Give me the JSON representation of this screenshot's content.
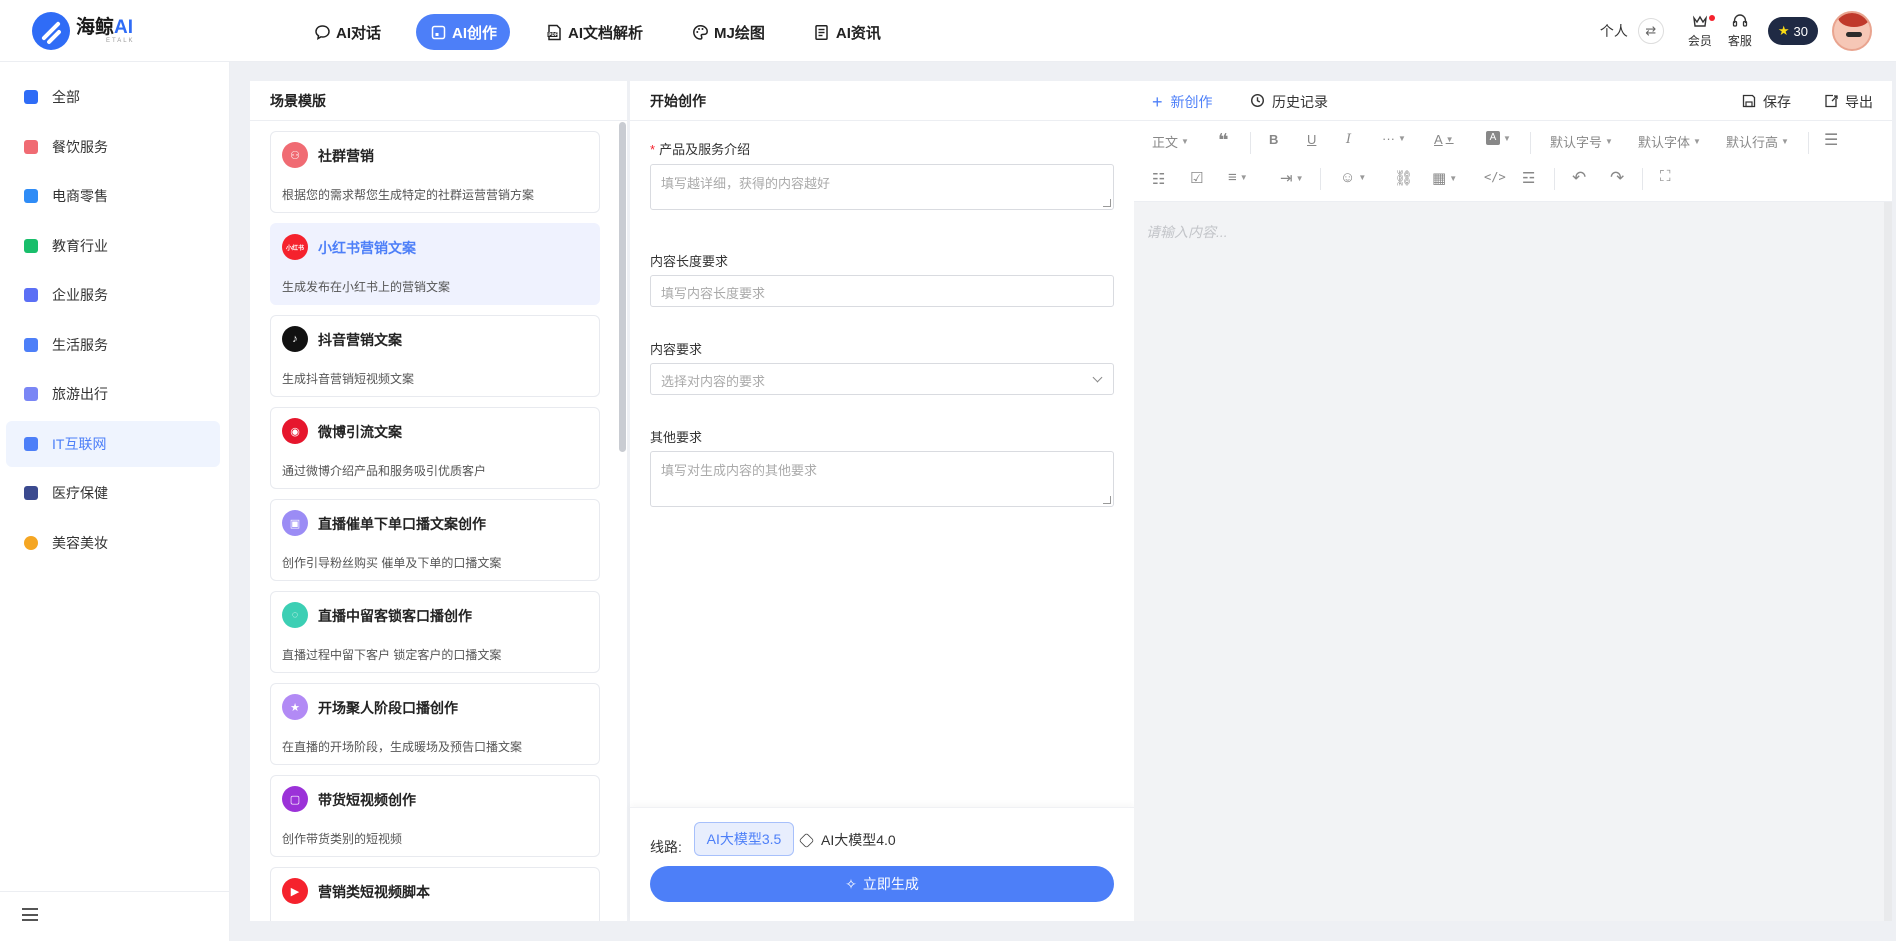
{
  "app": {
    "logo_name": "海鲸",
    "logo_ai": "AI",
    "logo_sub": "ETALK",
    "brand_color": "#2f6cf6",
    "accent_color": "#4d7ff8"
  },
  "nav": [
    {
      "label": "AI对话",
      "icon": "chat-icon",
      "active": false
    },
    {
      "label": "AI创作",
      "icon": "create-icon",
      "active": true
    },
    {
      "label": "AI文档解析",
      "icon": "pdf-icon",
      "active": false
    },
    {
      "label": "MJ绘图",
      "icon": "palette-icon",
      "active": false
    },
    {
      "label": "AI资讯",
      "icon": "news-icon",
      "active": false
    }
  ],
  "topbar": {
    "personal": "个人",
    "vip_label": "会员",
    "service_label": "客服",
    "points": "30"
  },
  "sidebar": {
    "items": [
      {
        "label": "全部",
        "icon": "windows-icon",
        "color": "#2f6cf6",
        "active": false
      },
      {
        "label": "餐饮服务",
        "icon": "food-icon",
        "color": "#f06b73",
        "active": false
      },
      {
        "label": "电商零售",
        "icon": "graduation-icon",
        "color": "#2f8cf6",
        "active": false
      },
      {
        "label": "教育行业",
        "icon": "book-icon",
        "color": "#19be6b",
        "active": false
      },
      {
        "label": "企业服务",
        "icon": "building-icon",
        "color": "#5b6ff5",
        "active": false
      },
      {
        "label": "生活服务",
        "icon": "brush-icon",
        "color": "#4d7ff8",
        "active": false
      },
      {
        "label": "旅游出行",
        "icon": "mountain-icon",
        "color": "#7a86f5",
        "active": false
      },
      {
        "label": "IT互联网",
        "icon": "document-icon",
        "color": "#4d7ff8",
        "active": true
      },
      {
        "label": "医疗保健",
        "icon": "hospital-icon",
        "color": "#3b4a8f",
        "active": false
      },
      {
        "label": "美容美妆",
        "icon": "smile-icon",
        "color": "#f5a623",
        "active": false
      }
    ]
  },
  "templates": {
    "title": "场景模版",
    "items": [
      {
        "title": "社群营销",
        "desc": "根据您的需求帮您生成特定的社群运营营销方案",
        "icon": "group-icon",
        "color": "#f06b73",
        "glyph": "⚇",
        "active": false
      },
      {
        "title": "小红书营销文案",
        "desc": "生成发布在小红书上的营销文案",
        "icon": "xiaohongshu-icon",
        "color": "#f5222d",
        "glyph": "小红书",
        "active": true
      },
      {
        "title": "抖音营销文案",
        "desc": "生成抖音营销短视频文案",
        "icon": "douyin-icon",
        "color": "#111111",
        "glyph": "♪",
        "active": false
      },
      {
        "title": "微博引流文案",
        "desc": "通过微博介绍产品和服务吸引优质客户",
        "icon": "weibo-icon",
        "color": "#e6162d",
        "glyph": "◉",
        "active": false
      },
      {
        "title": "直播催单下单口播文案创作",
        "desc": "创作引导粉丝购买 催单及下单的口播文案",
        "icon": "live-camera-icon",
        "color": "#9b8cf5",
        "glyph": "▣",
        "active": false
      },
      {
        "title": "直播中留客锁客口播创作",
        "desc": "直播过程中留下客户 锁定客户的口播文案",
        "icon": "chat-bubble-icon",
        "color": "#3ccfb4",
        "glyph": "◌",
        "active": false
      },
      {
        "title": "开场聚人阶段口播创作",
        "desc": "在直播的开场阶段，生成暖场及预告口播文案",
        "icon": "star-badge-icon",
        "color": "#b28af5",
        "glyph": "★",
        "active": false
      },
      {
        "title": "带货短视频创作",
        "desc": "创作带货类别的短视频",
        "icon": "shopping-icon",
        "color": "#9b32d8",
        "glyph": "▢",
        "active": false
      },
      {
        "title": "营销类短视频脚本",
        "desc": "",
        "icon": "play-icon",
        "color": "#f5222d",
        "glyph": "▶",
        "active": false
      }
    ]
  },
  "create": {
    "title": "开始创作",
    "fields": {
      "intro_label": "产品及服务介绍",
      "intro_placeholder": "填写越详细，获得的内容越好",
      "length_label": "内容长度要求",
      "length_placeholder": "填写内容长度要求",
      "req_label": "内容要求",
      "req_placeholder": "选择对内容的要求",
      "other_label": "其他要求",
      "other_placeholder": "填写对生成内容的其他要求"
    },
    "route_label": "线路:",
    "model_selected": "AI大模型3.5",
    "model_alt": "AI大模型4.0",
    "generate_label": "立即生成"
  },
  "editor": {
    "new_label": "新创作",
    "history_label": "历史记录",
    "save_label": "保存",
    "export_label": "导出",
    "toolbar": {
      "heading": "正文",
      "font_size": "默认字号",
      "font_family": "默认字体",
      "line_height": "默认行高"
    },
    "placeholder": "请输入内容..."
  }
}
